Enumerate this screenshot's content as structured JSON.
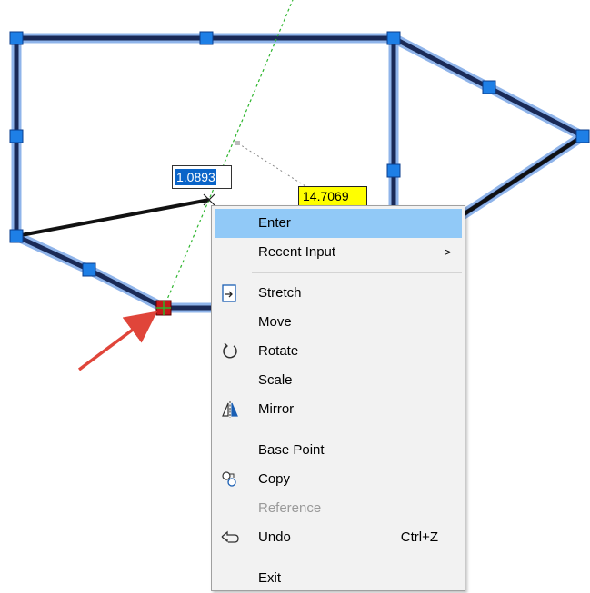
{
  "dynamic_input": {
    "value": "1.0893"
  },
  "dimension_tooltip": {
    "value": "14.7069"
  },
  "context_menu": {
    "enter": "Enter",
    "recent_input": "Recent Input",
    "submenu_arrow": ">",
    "stretch": "Stretch",
    "move": "Move",
    "rotate": "Rotate",
    "scale": "Scale",
    "mirror": "Mirror",
    "base_point": "Base Point",
    "copy": "Copy",
    "reference": "Reference",
    "undo": "Undo",
    "undo_shortcut": "Ctrl+Z",
    "exit": "Exit"
  },
  "colors": {
    "polyline": "#1a2a57",
    "highlight": "#8fb4ea",
    "grip": "#1e7fe6",
    "hot_grip": "#c41a1a",
    "menu_highlight": "#91c9f7",
    "tooltip": "#ffff00",
    "arrow": "#e0453a"
  }
}
